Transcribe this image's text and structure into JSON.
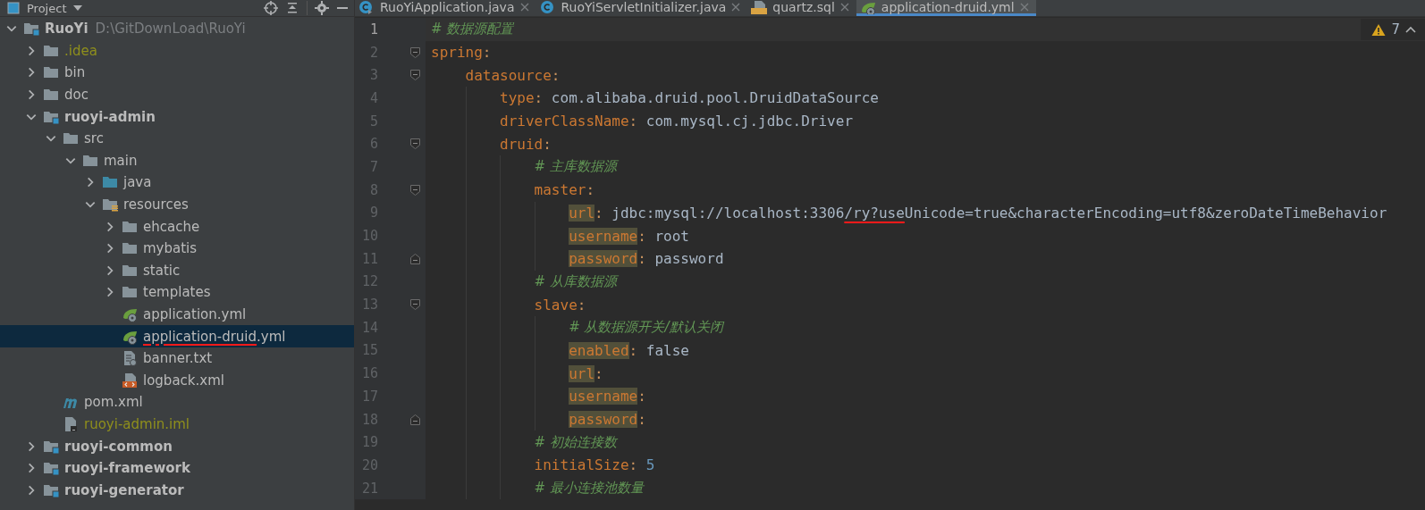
{
  "sidebar": {
    "title": "Project",
    "tree": [
      {
        "label": "RuoYi",
        "path": "D:\\GitDownLoad\\RuoYi",
        "kind": "module",
        "expanded": true,
        "selected": false,
        "ignored": false,
        "children": [
          {
            "label": ".idea",
            "kind": "folder",
            "expanded": false,
            "selected": false,
            "ignored": true
          },
          {
            "label": "bin",
            "kind": "folder",
            "expanded": false,
            "selected": false,
            "ignored": false
          },
          {
            "label": "doc",
            "kind": "folder",
            "expanded": false,
            "selected": false,
            "ignored": false
          },
          {
            "label": "ruoyi-admin",
            "kind": "module",
            "expanded": true,
            "selected": false,
            "ignored": false,
            "children": [
              {
                "label": "src",
                "kind": "folder",
                "expanded": true,
                "selected": false,
                "ignored": false,
                "children": [
                  {
                    "label": "main",
                    "kind": "folder",
                    "expanded": true,
                    "selected": false,
                    "ignored": false,
                    "children": [
                      {
                        "label": "java",
                        "kind": "source",
                        "expanded": false,
                        "selected": false,
                        "ignored": false
                      },
                      {
                        "label": "resources",
                        "kind": "resources",
                        "expanded": true,
                        "selected": false,
                        "ignored": false,
                        "children": [
                          {
                            "label": "ehcache",
                            "kind": "folder",
                            "expanded": false,
                            "selected": false,
                            "ignored": false
                          },
                          {
                            "label": "mybatis",
                            "kind": "folder",
                            "expanded": false,
                            "selected": false,
                            "ignored": false
                          },
                          {
                            "label": "static",
                            "kind": "folder",
                            "expanded": false,
                            "selected": false,
                            "ignored": false
                          },
                          {
                            "label": "templates",
                            "kind": "folder",
                            "expanded": false,
                            "selected": false,
                            "ignored": false
                          },
                          {
                            "label": "application.yml",
                            "kind": "spring",
                            "selected": false,
                            "ignored": false
                          },
                          {
                            "label_parts": [
                              {
                                "text": "application-druid",
                                "kind": "underlined"
                              },
                              {
                                "text": ".yml",
                                "kind": "plain"
                              }
                            ],
                            "kind": "spring",
                            "selected": true,
                            "ignored": false
                          },
                          {
                            "label": "banner.txt",
                            "kind": "text",
                            "selected": false,
                            "ignored": false
                          },
                          {
                            "label": "logback.xml",
                            "kind": "xml",
                            "selected": false,
                            "ignored": false
                          }
                        ]
                      }
                    ]
                  }
                ]
              },
              {
                "label": "pom.xml",
                "kind": "maven",
                "selected": false,
                "ignored": false
              },
              {
                "label": "ruoyi-admin.iml",
                "kind": "iml",
                "selected": false,
                "ignored": true
              }
            ]
          },
          {
            "label": "ruoyi-common",
            "kind": "module",
            "expanded": false,
            "selected": false,
            "ignored": false
          },
          {
            "label": "ruoyi-framework",
            "kind": "module",
            "expanded": false,
            "selected": false,
            "ignored": false
          },
          {
            "label": "ruoyi-generator",
            "kind": "module",
            "expanded": false,
            "selected": false,
            "ignored": false
          }
        ]
      }
    ]
  },
  "tabs": [
    {
      "label": "RuoYiApplication.java",
      "kind": "java_run",
      "selected": false
    },
    {
      "label": "RuoYiServletInitializer.java",
      "kind": "java",
      "selected": false
    },
    {
      "label": "quartz.sql",
      "kind": "sql",
      "selected": false
    },
    {
      "label": "application-druid.yml",
      "kind": "spring",
      "selected": true
    }
  ],
  "editor": {
    "inspection": {
      "count": "7"
    },
    "lines": [
      {
        "number": "1",
        "fold_start": false,
        "fold_end": false,
        "current": true,
        "tokens": [
          {
            "kind": "comment",
            "text": "# 数据源配置"
          }
        ]
      },
      {
        "number": "2",
        "fold_start": true,
        "fold_end": false,
        "current": false,
        "tokens": [
          {
            "kind": "key",
            "text": "spring"
          },
          {
            "kind": "punct",
            "text": ":"
          }
        ],
        "children": [
          {
            "number": "3",
            "fold_start": true,
            "fold_end": false,
            "current": false,
            "tokens": [
              {
                "kind": "key",
                "text": "datasource"
              },
              {
                "kind": "punct",
                "text": ":"
              }
            ],
            "children": [
              {
                "number": "4",
                "fold_start": false,
                "fold_end": false,
                "current": false,
                "tokens": [
                  {
                    "kind": "key",
                    "text": "type"
                  },
                  {
                    "kind": "punct",
                    "text": ": "
                  },
                  {
                    "kind": "value",
                    "text": "com.alibaba.druid.pool.DruidDataSource"
                  }
                ]
              },
              {
                "number": "5",
                "fold_start": false,
                "fold_end": false,
                "current": false,
                "tokens": [
                  {
                    "kind": "key",
                    "text": "driverClassName"
                  },
                  {
                    "kind": "punct",
                    "text": ": "
                  },
                  {
                    "kind": "value",
                    "text": "com.mysql.cj.jdbc.Driver"
                  }
                ]
              },
              {
                "number": "6",
                "fold_start": true,
                "fold_end": false,
                "current": false,
                "tokens": [
                  {
                    "kind": "key",
                    "text": "druid"
                  },
                  {
                    "kind": "punct",
                    "text": ":"
                  }
                ],
                "children": [
                  {
                    "number": "7",
                    "fold_start": false,
                    "fold_end": false,
                    "current": false,
                    "tokens": [
                      {
                        "kind": "comment",
                        "text": "# 主库数据源"
                      }
                    ]
                  },
                  {
                    "number": "8",
                    "fold_start": true,
                    "fold_end": false,
                    "current": false,
                    "tokens": [
                      {
                        "kind": "key",
                        "text": "master"
                      },
                      {
                        "kind": "punct",
                        "text": ":"
                      }
                    ],
                    "children": [
                      {
                        "number": "9",
                        "fold_start": false,
                        "fold_end": false,
                        "current": false,
                        "tokens": [
                          {
                            "kind": "key_marked",
                            "text": "url"
                          },
                          {
                            "kind": "punct",
                            "text": ": "
                          },
                          {
                            "kind": "value",
                            "text": "jdbc:mysql://localhost:3306"
                          },
                          {
                            "kind": "value_underlined",
                            "text": "/ry?use"
                          },
                          {
                            "kind": "value",
                            "text": "Unicode=true&characterEncoding=utf8&zeroDateTimeBehavior"
                          }
                        ]
                      },
                      {
                        "number": "10",
                        "fold_start": false,
                        "fold_end": false,
                        "current": false,
                        "tokens": [
                          {
                            "kind": "key_marked",
                            "text": "username"
                          },
                          {
                            "kind": "punct",
                            "text": ": "
                          },
                          {
                            "kind": "value",
                            "text": "root"
                          }
                        ]
                      },
                      {
                        "number": "11",
                        "fold_start": false,
                        "fold_end": true,
                        "current": false,
                        "tokens": [
                          {
                            "kind": "key_marked",
                            "text": "password"
                          },
                          {
                            "kind": "punct",
                            "text": ": "
                          },
                          {
                            "kind": "value",
                            "text": "password"
                          }
                        ]
                      }
                    ]
                  },
                  {
                    "number": "12",
                    "fold_start": false,
                    "fold_end": false,
                    "current": false,
                    "tokens": [
                      {
                        "kind": "comment",
                        "text": "# 从库数据源"
                      }
                    ]
                  },
                  {
                    "number": "13",
                    "fold_start": true,
                    "fold_end": false,
                    "current": false,
                    "tokens": [
                      {
                        "kind": "key",
                        "text": "slave"
                      },
                      {
                        "kind": "punct",
                        "text": ":"
                      }
                    ],
                    "children": [
                      {
                        "number": "14",
                        "fold_start": false,
                        "fold_end": false,
                        "current": false,
                        "tokens": [
                          {
                            "kind": "comment",
                            "text": "# 从数据源开关/默认关闭"
                          }
                        ]
                      },
                      {
                        "number": "15",
                        "fold_start": false,
                        "fold_end": false,
                        "current": false,
                        "tokens": [
                          {
                            "kind": "key_marked",
                            "text": "enabled"
                          },
                          {
                            "kind": "punct",
                            "text": ": "
                          },
                          {
                            "kind": "value",
                            "text": "false"
                          }
                        ]
                      },
                      {
                        "number": "16",
                        "fold_start": false,
                        "fold_end": false,
                        "current": false,
                        "tokens": [
                          {
                            "kind": "key_marked",
                            "text": "url"
                          },
                          {
                            "kind": "punct",
                            "text": ":"
                          }
                        ]
                      },
                      {
                        "number": "17",
                        "fold_start": false,
                        "fold_end": false,
                        "current": false,
                        "tokens": [
                          {
                            "kind": "key_marked",
                            "text": "username"
                          },
                          {
                            "kind": "punct",
                            "text": ":"
                          }
                        ]
                      },
                      {
                        "number": "18",
                        "fold_start": false,
                        "fold_end": true,
                        "current": false,
                        "tokens": [
                          {
                            "kind": "key_marked",
                            "text": "password"
                          },
                          {
                            "kind": "punct",
                            "text": ":"
                          }
                        ]
                      }
                    ]
                  },
                  {
                    "number": "19",
                    "fold_start": false,
                    "fold_end": false,
                    "current": false,
                    "tokens": [
                      {
                        "kind": "comment",
                        "text": "# 初始连接数"
                      }
                    ]
                  },
                  {
                    "number": "20",
                    "fold_start": false,
                    "fold_end": false,
                    "current": false,
                    "tokens": [
                      {
                        "kind": "key",
                        "text": "initialSize"
                      },
                      {
                        "kind": "punct",
                        "text": ": "
                      },
                      {
                        "kind": "number",
                        "text": "5"
                      }
                    ]
                  },
                  {
                    "number": "21",
                    "fold_start": false,
                    "fold_end": false,
                    "current": false,
                    "tokens": [
                      {
                        "kind": "comment",
                        "text": "# 最小连接池数量"
                      }
                    ]
                  }
                ]
              }
            ]
          }
        ]
      }
    ]
  }
}
